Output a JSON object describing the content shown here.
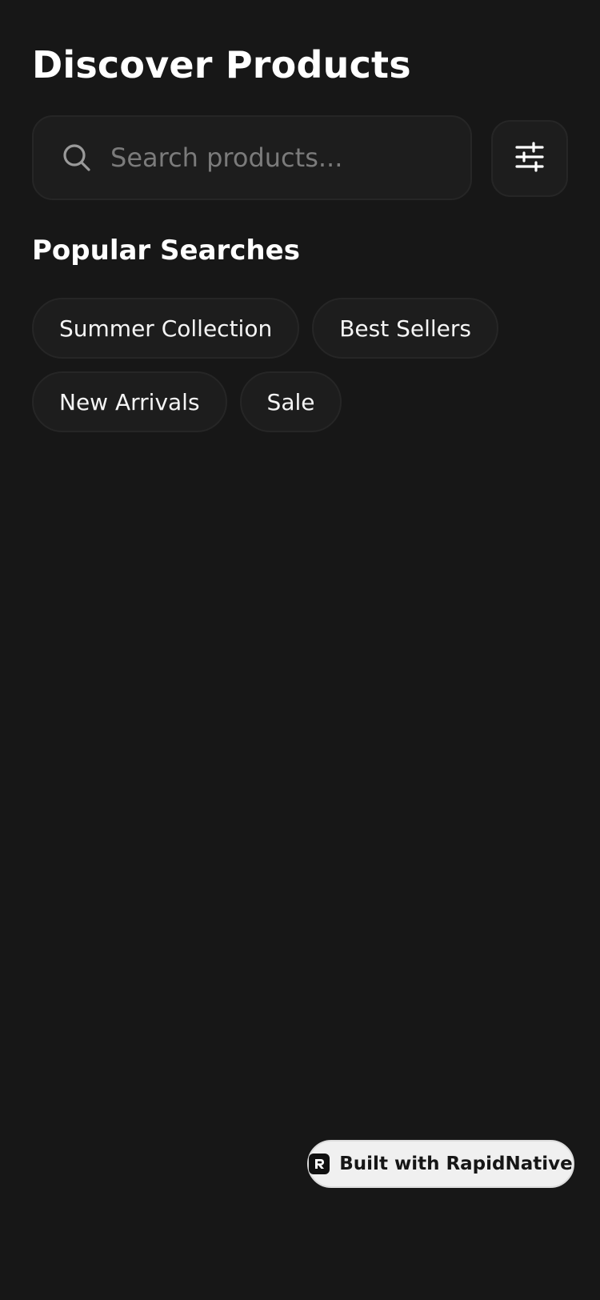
{
  "header": {
    "title": "Discover Products"
  },
  "search": {
    "placeholder": "Search products...",
    "value": ""
  },
  "popular": {
    "title": "Popular Searches",
    "chips": [
      {
        "label": "Summer Collection"
      },
      {
        "label": "Best Sellers"
      },
      {
        "label": "New Arrivals"
      },
      {
        "label": "Sale"
      }
    ]
  },
  "badge": {
    "label": "Built with RapidNative"
  },
  "icons": {
    "search": "search-icon",
    "filter": "sliders-icon",
    "logo": "rapidnative-logo-icon"
  },
  "colors": {
    "background": "#171717",
    "surface": "#1d1d1d",
    "border": "#262626",
    "text": "#ffffff",
    "placeholder": "#7b7b7b",
    "badge_bg": "#f0f0f0"
  }
}
